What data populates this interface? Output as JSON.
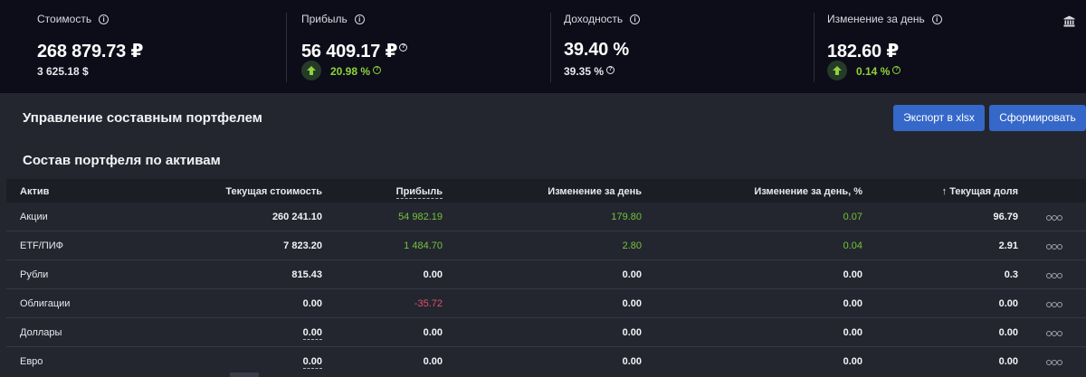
{
  "summary": {
    "value": {
      "label": "Стоимость",
      "amount": "268 879.73 ₽",
      "sub": "3 625.18 $"
    },
    "profit": {
      "label": "Прибыль",
      "amount": "56 409.17 ₽",
      "pct": "20.98 %"
    },
    "yield": {
      "label": "Доходность",
      "amount": "39.40 %",
      "sub": "39.35 %"
    },
    "day_change": {
      "label": "Изменение за день",
      "amount": "182.60 ₽",
      "pct": "0.14 %"
    }
  },
  "management": {
    "title": "Управление составным портфелем",
    "export_label": "Экспорт в xlsx",
    "form_label": "Сформировать"
  },
  "composition": {
    "title": "Состав портфеля по активам",
    "headers": {
      "asset": "Актив",
      "value": "Текущая стоимость",
      "profit": "Прибыль",
      "day_change": "Изменение за день",
      "day_change_pct": "Изменение за день, %",
      "share": "Текущая доля",
      "share_sort_arrow": "↑"
    },
    "rows": [
      {
        "asset": "Акции",
        "value": "260 241.10",
        "profit": "54 982.19",
        "day_change": "179.80",
        "day_change_pct": "0.07",
        "share": "96.79"
      },
      {
        "asset": "ETF/ПИФ",
        "value": "7 823.20",
        "profit": "1 484.70",
        "day_change": "2.80",
        "day_change_pct": "0.04",
        "share": "2.91"
      },
      {
        "asset": "Рубли",
        "value": "815.43",
        "profit": "0.00",
        "day_change": "0.00",
        "day_change_pct": "0.00",
        "share": "0.3"
      },
      {
        "asset": "Облигации",
        "value": "0.00",
        "profit": "-35.72",
        "day_change": "0.00",
        "day_change_pct": "0.00",
        "share": "0.00"
      },
      {
        "asset": "Доллары",
        "value": "0.00",
        "profit": "0.00",
        "day_change": "0.00",
        "day_change_pct": "0.00",
        "share": "0.00"
      },
      {
        "asset": "Евро",
        "value": "0.00",
        "profit": "0.00",
        "day_change": "0.00",
        "day_change_pct": "0.00",
        "share": "0.00"
      }
    ]
  },
  "icons": {
    "info": "info-icon",
    "up": "arrow-up-icon",
    "bank": "bank-icon",
    "more": "more-options-icon"
  },
  "colors": {
    "accent": "#3568c9",
    "positive": "#74c33a",
    "negative": "#e0506a",
    "header_bg": "#0c0d18"
  }
}
